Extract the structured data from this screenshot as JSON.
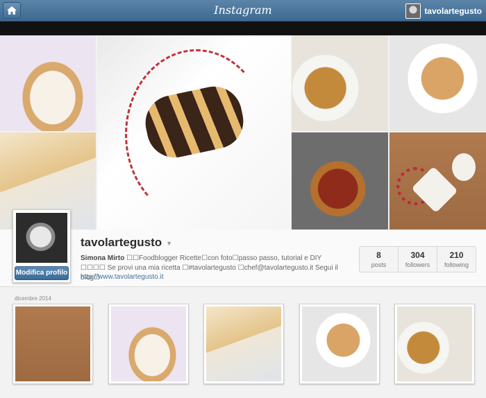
{
  "header": {
    "logo": "Instagram",
    "username": "tavolartegusto"
  },
  "profile": {
    "username": "tavolartegusto",
    "edit_button": "Modifica profilo",
    "bio_name": "Simona Mirto",
    "bio_text": " ☐☐Foodblogger Ricette☐con foto☐passo passo, tutorial e DIY ☐☐☐☐ Se provi una mia ricetta ☐#tavolartegusto ☐chef@tavolartegusto.it Segui il blog☐",
    "website": "http://www.tavolartegusto.it",
    "stats": [
      {
        "num": "8",
        "label": "posts"
      },
      {
        "num": "304",
        "label": "followers"
      },
      {
        "num": "210",
        "label": "following"
      }
    ]
  },
  "feed": {
    "month_label": "dicembre 2014"
  }
}
